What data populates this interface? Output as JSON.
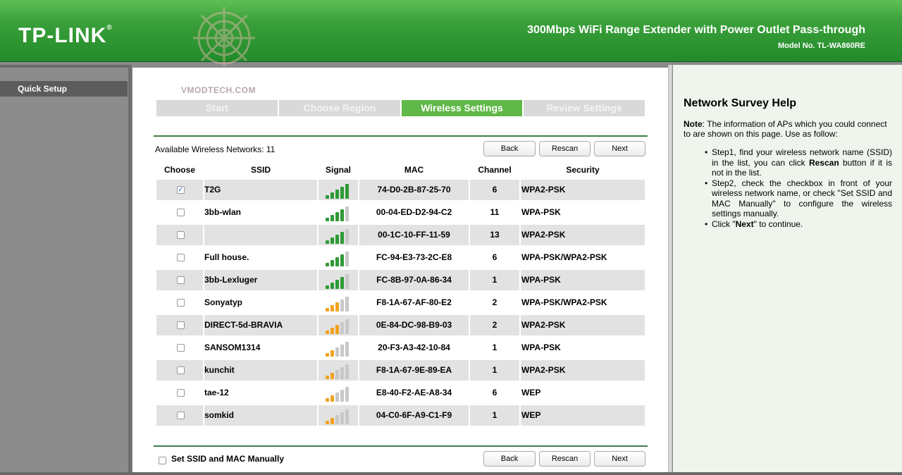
{
  "header": {
    "logo": "TP-LINK",
    "logo_mark": "®",
    "product_title": "300Mbps WiFi Range Extender with Power Outlet Pass-through",
    "model_no": "Model No. TL-WA860RE",
    "watermark_text": "VMODTECH.COM"
  },
  "sidebar": {
    "items": [
      {
        "label": "Quick Setup"
      }
    ]
  },
  "steps": [
    {
      "label": "Start",
      "active": false
    },
    {
      "label": "Choose Region",
      "active": false
    },
    {
      "label": "Wireless Settings",
      "active": true
    },
    {
      "label": "Review Settings",
      "active": false
    }
  ],
  "survey": {
    "available_label": "Available Wireless Networks: 11",
    "buttons": {
      "back": "Back",
      "rescan": "Rescan",
      "next": "Next"
    },
    "columns": [
      "Choose",
      "SSID",
      "Signal",
      "MAC",
      "Channel",
      "Security"
    ],
    "networks": [
      {
        "checked": true,
        "ssid": "T2G",
        "signal": 5,
        "signal_color": "green",
        "mac": "74-D0-2B-87-25-70",
        "channel": "6",
        "security": "WPA2-PSK"
      },
      {
        "checked": false,
        "ssid": "3bb-wlan",
        "signal": 4,
        "signal_color": "green",
        "mac": "00-04-ED-D2-94-C2",
        "channel": "11",
        "security": "WPA-PSK"
      },
      {
        "checked": false,
        "ssid": "",
        "signal": 4,
        "signal_color": "green",
        "mac": "00-1C-10-FF-11-59",
        "channel": "13",
        "security": "WPA2-PSK"
      },
      {
        "checked": false,
        "ssid": "Full house.",
        "signal": 4,
        "signal_color": "green",
        "mac": "FC-94-E3-73-2C-E8",
        "channel": "6",
        "security": "WPA-PSK/WPA2-PSK"
      },
      {
        "checked": false,
        "ssid": "3bb-Lexluger",
        "signal": 4,
        "signal_color": "green",
        "mac": "FC-8B-97-0A-86-34",
        "channel": "1",
        "security": "WPA-PSK"
      },
      {
        "checked": false,
        "ssid": "Sonyatyp",
        "signal": 3,
        "signal_color": "orange",
        "mac": "F8-1A-67-AF-80-E2",
        "channel": "2",
        "security": "WPA-PSK/WPA2-PSK"
      },
      {
        "checked": false,
        "ssid": "DIRECT-5d-BRAVIA",
        "signal": 3,
        "signal_color": "orange",
        "mac": "0E-84-DC-98-B9-03",
        "channel": "2",
        "security": "WPA2-PSK"
      },
      {
        "checked": false,
        "ssid": "SANSOM1314",
        "signal": 2,
        "signal_color": "orange",
        "mac": "20-F3-A3-42-10-84",
        "channel": "1",
        "security": "WPA-PSK"
      },
      {
        "checked": false,
        "ssid": "kunchit",
        "signal": 2,
        "signal_color": "orange",
        "mac": "F8-1A-67-9E-89-EA",
        "channel": "1",
        "security": "WPA2-PSK"
      },
      {
        "checked": false,
        "ssid": "tae-12",
        "signal": 2,
        "signal_color": "orange",
        "mac": "E8-40-F2-AE-A8-34",
        "channel": "6",
        "security": "WEP"
      },
      {
        "checked": false,
        "ssid": "somkid",
        "signal": 2,
        "signal_color": "orange",
        "mac": "04-C0-6F-A9-C1-F9",
        "channel": "1",
        "security": "WEP"
      }
    ],
    "manual_label": "Set SSID and MAC Manually"
  },
  "help": {
    "title": "Network Survey Help",
    "note_label": "Note",
    "note_text": ": The information of APs which you could connect to are shown on this page. Use as follow:",
    "step1_a": "Step1, find your wireless network name (SSID) in the list, you can click ",
    "step1_b": "Rescan",
    "step1_c": " button if it is not in the list.",
    "step2": "Step2, check the checkbox in front of your wireless network name, or check \"Set SSID and MAC Manually\" to configure the wireless settings manually.",
    "step3_a": "Click \"",
    "step3_b": "Next",
    "step3_c": "\" to continue."
  },
  "colors": {
    "brand_green": "#228b2a",
    "step_active": "#5fb847",
    "signal_green": "#2e9a35",
    "signal_orange": "#f0a21e",
    "signal_empty": "#c8c8c8"
  }
}
